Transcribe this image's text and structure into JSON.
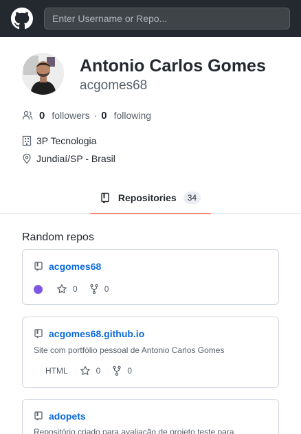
{
  "header": {
    "logo": "github-logo",
    "search_placeholder": "Enter Username or Repo..."
  },
  "profile": {
    "name": "Antonio Carlos Gomes",
    "login": "acgomes68",
    "followers_count": "0",
    "followers_label": "followers",
    "separator": "·",
    "following_count": "0",
    "following_label": "following",
    "company": "3P Tecnologia",
    "location": "Jundiaí/SP - Brasil"
  },
  "tabs": [
    {
      "label": "Repositories",
      "count": "34",
      "icon": "repo-icon",
      "selected": true
    }
  ],
  "section": {
    "title": "Random repos"
  },
  "repos": [
    {
      "name": "acgomes68",
      "description": "",
      "language": "",
      "language_color": "#7e57e2",
      "stars": "0",
      "forks": "0"
    },
    {
      "name": "acgomes68.github.io",
      "description": "Site com portfólio pessoal de Antonio Carlos Gomes",
      "language": "HTML",
      "language_color": "",
      "stars": "0",
      "forks": "0"
    },
    {
      "name": "adopets",
      "description": "Repositório criado para avaliação de projeto teste para",
      "language": "",
      "language_color": "",
      "stars": "",
      "forks": ""
    }
  ],
  "colors": {
    "header_bg": "#24292f",
    "link": "#0969da",
    "selected_tab_underline": "#fd8c73"
  }
}
